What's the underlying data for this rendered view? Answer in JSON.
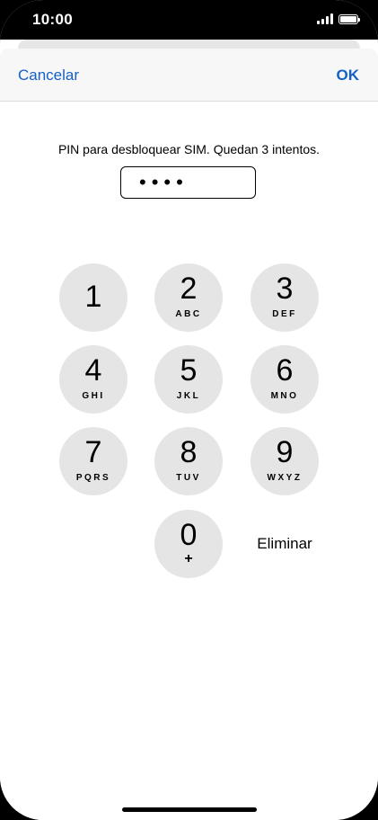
{
  "status_bar": {
    "time": "10:00",
    "signal_icon": "signal-bars-icon",
    "battery_icon": "battery-icon"
  },
  "navbar": {
    "cancel_label": "Cancelar",
    "ok_label": "OK",
    "accent_color": "#1560c8"
  },
  "prompt": "PIN para desbloquear SIM. Quedan 3 intentos.",
  "pin_field": {
    "value": "••••"
  },
  "keypad": {
    "keys": [
      {
        "digit": "1",
        "letters": ""
      },
      {
        "digit": "2",
        "letters": "ABC"
      },
      {
        "digit": "3",
        "letters": "DEF"
      },
      {
        "digit": "4",
        "letters": "GHI"
      },
      {
        "digit": "5",
        "letters": "JKL"
      },
      {
        "digit": "6",
        "letters": "MNO"
      },
      {
        "digit": "7",
        "letters": "PQRS"
      },
      {
        "digit": "8",
        "letters": "TUV"
      },
      {
        "digit": "9",
        "letters": "WXYZ"
      },
      {
        "digit": "0",
        "letters": "+"
      }
    ],
    "delete_label": "Eliminar"
  }
}
